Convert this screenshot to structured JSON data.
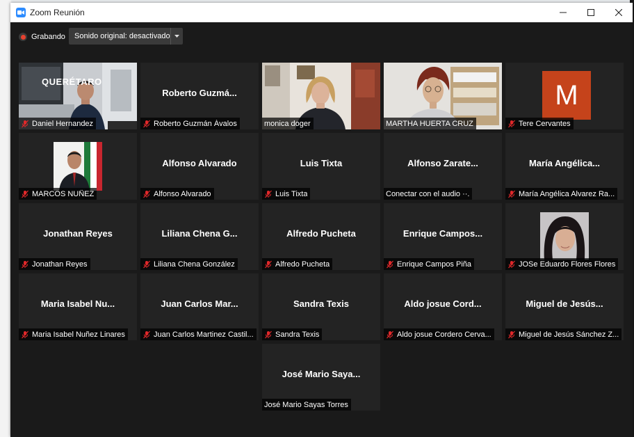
{
  "window": {
    "title": "Zoom Reunión",
    "minimize": "—",
    "maximize": "☐",
    "close": "✕"
  },
  "toolbar": {
    "recording_label": "Grabando",
    "audio_label": "Sonido original: desactivado",
    "dropdown_icon": "chevron-down-icon"
  },
  "colors": {
    "accent": "#2d8cff",
    "active_speaker": "#cfe31f",
    "muted_mic": "#e0282a",
    "avatar_bg": "#c5431b",
    "tile_bg": "#232323"
  },
  "participants": [
    {
      "display_name": "Daniel Hernandez",
      "label": "",
      "muted": true,
      "has_video": true
    },
    {
      "display_name": "Roberto Guzmán Ávalos",
      "label": "Roberto Guzmá...",
      "muted": true,
      "has_video": false
    },
    {
      "display_name": "monica doger",
      "label": "",
      "muted": false,
      "has_video": true
    },
    {
      "display_name": "MARTHA HUERTA CRUZ",
      "label": "",
      "muted": false,
      "has_video": true,
      "active_speaker": true
    },
    {
      "display_name": "Tere Cervantes",
      "label": "",
      "muted": true,
      "has_video": false,
      "avatar_letter": "M"
    },
    {
      "display_name": "MARCOS NUÑEZ",
      "label": "",
      "muted": true,
      "has_video": true
    },
    {
      "display_name": "Alfonso Alvarado",
      "label": "Alfonso Alvarado",
      "muted": true,
      "has_video": false
    },
    {
      "display_name": "Luis Tixta",
      "label": "Luis Tixta",
      "muted": true,
      "has_video": false
    },
    {
      "display_name": "Conectar con el audio ··.",
      "label": "Alfonso Zarate...",
      "muted": false,
      "has_video": false
    },
    {
      "display_name": "María Angélica Alvarez Ra...",
      "label": "María Angélica...",
      "muted": true,
      "has_video": false
    },
    {
      "display_name": "Jonathan Reyes",
      "label": "Jonathan Reyes",
      "muted": true,
      "has_video": false
    },
    {
      "display_name": "Liliana Chena González",
      "label": "Liliana Chena G...",
      "muted": true,
      "has_video": false
    },
    {
      "display_name": "Alfredo Pucheta",
      "label": "Alfredo Pucheta",
      "muted": true,
      "has_video": false
    },
    {
      "display_name": "Enrique Campos Piña",
      "label": "Enrique Campos...",
      "muted": true,
      "has_video": false
    },
    {
      "display_name": "JOSe Eduardo Flores Flores",
      "label": "",
      "muted": true,
      "has_video": true
    },
    {
      "display_name": "Maria Isabel Nuñez Linares",
      "label": "Maria Isabel Nu...",
      "muted": true,
      "has_video": false
    },
    {
      "display_name": "Juan Carlos Martinez Castil...",
      "label": "Juan Carlos Mar...",
      "muted": true,
      "has_video": false
    },
    {
      "display_name": "Sandra Texis",
      "label": "Sandra Texis",
      "muted": true,
      "has_video": false
    },
    {
      "display_name": "Aldo josue Cordero Cerva...",
      "label": "Aldo josue Cord...",
      "muted": true,
      "has_video": false
    },
    {
      "display_name": "Miguel de Jesús Sánchez Z...",
      "label": "Miguel de Jesús...",
      "muted": true,
      "has_video": false
    },
    {
      "display_name": "José Mario Sayas Torres",
      "label": "José Mario Saya...",
      "muted": false,
      "has_video": false
    }
  ],
  "video_overlays": {
    "daniel_logo_text": "QUERÉTARO"
  }
}
